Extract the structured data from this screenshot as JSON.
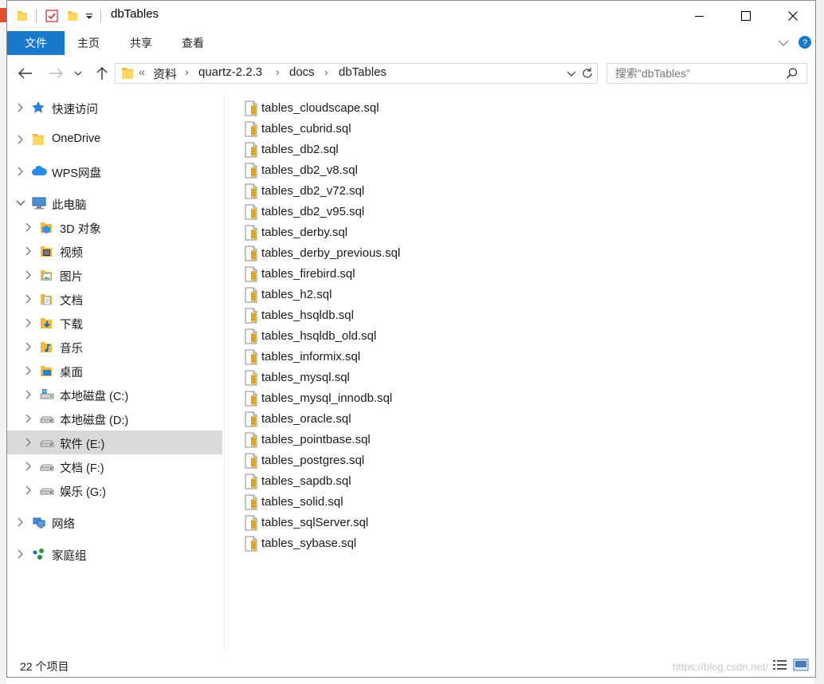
{
  "window": {
    "title": "dbTables",
    "accent_color": "#1979ca"
  },
  "ribbon": {
    "tabs": [
      {
        "label": "文件"
      },
      {
        "label": "主页"
      },
      {
        "label": "共享"
      },
      {
        "label": "查看"
      }
    ]
  },
  "address": {
    "overflow_label": "«",
    "breadcrumbs": [
      {
        "label": "资料"
      },
      {
        "label": "quartz-2.2.3"
      },
      {
        "label": "docs"
      },
      {
        "label": "dbTables"
      }
    ]
  },
  "search": {
    "placeholder": "搜索\"dbTables\""
  },
  "sidebar": {
    "items": [
      {
        "label": "快速访问",
        "icon": "star-icon"
      },
      {
        "label": "OneDrive",
        "icon": "folder-icon"
      },
      {
        "label": "WPS网盘",
        "icon": "cloud-icon"
      },
      {
        "label": "此电脑",
        "icon": "computer-icon"
      },
      {
        "label": "3D 对象",
        "icon": "3d-objects-icon"
      },
      {
        "label": "视频",
        "icon": "video-icon"
      },
      {
        "label": "图片",
        "icon": "pictures-icon"
      },
      {
        "label": "文档",
        "icon": "documents-icon"
      },
      {
        "label": "下载",
        "icon": "download-icon"
      },
      {
        "label": "音乐",
        "icon": "music-icon"
      },
      {
        "label": "桌面",
        "icon": "desktop-icon"
      },
      {
        "label": "本地磁盘 (C:)",
        "icon": "system-drive-icon"
      },
      {
        "label": "本地磁盘 (D:)",
        "icon": "drive-icon"
      },
      {
        "label": "软件 (E:)",
        "icon": "drive-icon",
        "selected": true
      },
      {
        "label": "文档 (F:)",
        "icon": "drive-icon"
      },
      {
        "label": "娱乐 (G:)",
        "icon": "drive-icon"
      },
      {
        "label": "网络",
        "icon": "network-icon"
      },
      {
        "label": "家庭组",
        "icon": "homegroup-icon"
      }
    ]
  },
  "files": [
    {
      "name": "tables_cloudscape.sql"
    },
    {
      "name": "tables_cubrid.sql"
    },
    {
      "name": "tables_db2.sql"
    },
    {
      "name": "tables_db2_v8.sql"
    },
    {
      "name": "tables_db2_v72.sql"
    },
    {
      "name": "tables_db2_v95.sql"
    },
    {
      "name": "tables_derby.sql"
    },
    {
      "name": "tables_derby_previous.sql"
    },
    {
      "name": "tables_firebird.sql"
    },
    {
      "name": "tables_h2.sql"
    },
    {
      "name": "tables_hsqldb.sql"
    },
    {
      "name": "tables_hsqldb_old.sql"
    },
    {
      "name": "tables_informix.sql"
    },
    {
      "name": "tables_mysql.sql"
    },
    {
      "name": "tables_mysql_innodb.sql"
    },
    {
      "name": "tables_oracle.sql"
    },
    {
      "name": "tables_pointbase.sql"
    },
    {
      "name": "tables_postgres.sql"
    },
    {
      "name": "tables_sapdb.sql"
    },
    {
      "name": "tables_solid.sql"
    },
    {
      "name": "tables_sqlServer.sql"
    },
    {
      "name": "tables_sybase.sql"
    }
  ],
  "status": {
    "item_count": "22 个项目",
    "watermark": "https://blog.csdn.net/..."
  }
}
